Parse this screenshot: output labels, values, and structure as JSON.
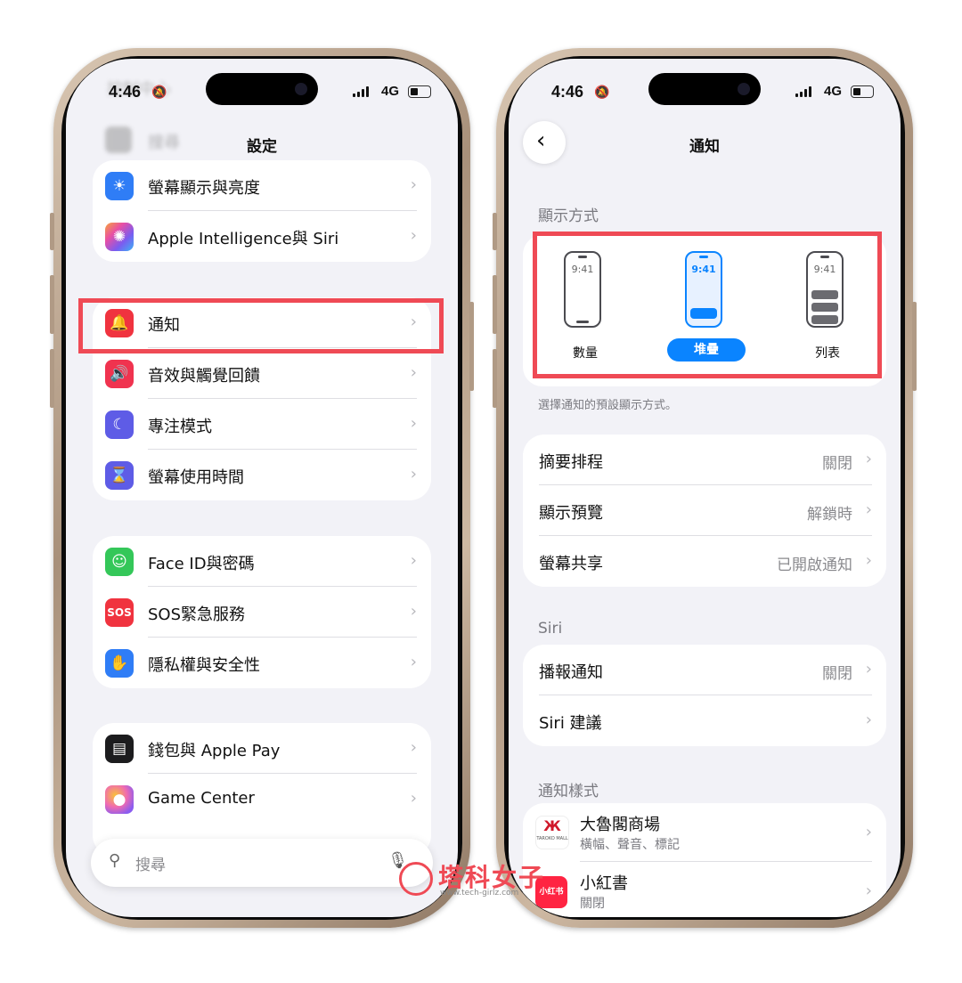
{
  "left": {
    "status": {
      "time": "4:46",
      "network": "4G"
    },
    "title": "設定",
    "blurred": {
      "top_item": "控制中心",
      "search_item": "搜尋"
    },
    "group1": [
      {
        "label": "螢幕顯示與亮度",
        "icon": "sun-icon",
        "color": "#2f7df6"
      },
      {
        "label": "Apple Intelligence與 Siri",
        "icon": "apple-intelligence-icon",
        "color": "#b25cf0"
      }
    ],
    "group2": [
      {
        "label": "通知",
        "icon": "bell-icon",
        "color": "#f0333f"
      },
      {
        "label": "音效與觸覺回饋",
        "icon": "speaker-icon",
        "color": "#f0334f"
      },
      {
        "label": "專注模式",
        "icon": "moon-icon",
        "color": "#5e5ce6"
      },
      {
        "label": "螢幕使用時間",
        "icon": "hourglass-icon",
        "color": "#5e5ce6"
      }
    ],
    "group3": [
      {
        "label": "Face ID與密碼",
        "icon": "faceid-icon",
        "color": "#34c759"
      },
      {
        "label": "SOS緊急服務",
        "icon": "sos-icon",
        "color": "#f0333f",
        "icon_text": "SOS"
      },
      {
        "label": "隱私權與安全性",
        "icon": "hand-icon",
        "color": "#2f7df6"
      }
    ],
    "group4": [
      {
        "label": "錢包與 Apple Pay",
        "icon": "wallet-icon",
        "color": "#1c1c1e"
      },
      {
        "label": "Game Center",
        "icon": "game-center-icon",
        "color": "#f06bb0"
      }
    ],
    "search_placeholder": "搜尋"
  },
  "right": {
    "status": {
      "time": "4:46",
      "network": "4G"
    },
    "title": "通知",
    "display_section": "顯示方式",
    "display_options": [
      {
        "label": "數量",
        "time": "9:41",
        "selected": false
      },
      {
        "label": "堆疊",
        "time": "9:41",
        "selected": true
      },
      {
        "label": "列表",
        "time": "9:41",
        "selected": false
      }
    ],
    "display_footer": "選擇通知的預設顯示方式。",
    "group1": [
      {
        "label": "摘要排程",
        "value": "關閉"
      },
      {
        "label": "顯示預覽",
        "value": "解鎖時"
      },
      {
        "label": "螢幕共享",
        "value": "已開啟通知"
      }
    ],
    "siri_section": "Siri",
    "siri_group": [
      {
        "label": "播報通知",
        "value": "關閉"
      },
      {
        "label": "Siri 建議",
        "value": ""
      }
    ],
    "style_section": "通知樣式",
    "apps": [
      {
        "name": "大魯閣商場",
        "detail": "橫幅、聲音、標記",
        "icon_text": "TAROKO MALL"
      },
      {
        "name": "小紅書",
        "detail": "關閉",
        "icon_text": "小红书"
      }
    ]
  },
  "watermark": {
    "title": "塔科女子",
    "url": "www.tech-girlz.com"
  },
  "colors": {
    "highlight": "#ef4a55",
    "accent": "#0a84ff",
    "chevron": "#b7b7bc"
  }
}
